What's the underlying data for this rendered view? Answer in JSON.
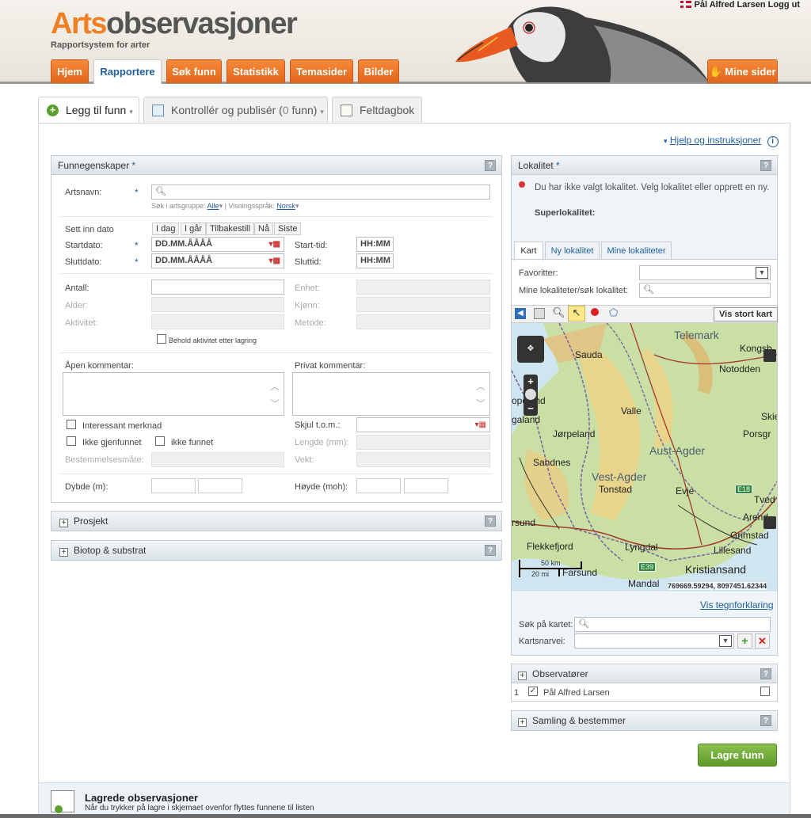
{
  "header": {
    "logo_prefix": "Arts",
    "logo_suffix": "observasjoner",
    "tagline": "Rapportsystem for arter",
    "user_name": "Pål Alfred Larsen",
    "logout": "Logg ut"
  },
  "nav": {
    "home": "Hjem",
    "report": "Rapportere",
    "search": "Søk funn",
    "stats": "Statistikk",
    "themes": "Temasider",
    "images": "Bilder",
    "my_pages": "Mine sider"
  },
  "page_tabs": {
    "add": "Legg til funn",
    "control_prefix": "Kontrollér og publisér (",
    "control_count": "0",
    "control_suffix": " funn)",
    "diary": "Feltdagbok"
  },
  "help_link": "Hjelp og instruksjoner",
  "findings": {
    "title": "Funnegenskaper",
    "species_label": "Artsnavn:",
    "search_group_label": "Søk i artsgruppe:",
    "search_group_value": "Alle",
    "display_lang_label": "Visningsspråk:",
    "display_lang_value": "Norsk",
    "insert_date_label": "Sett inn dato",
    "date_buttons": [
      "I dag",
      "I går",
      "Tilbakestill",
      "Nå",
      "Siste"
    ],
    "start_date_label": "Startdato:",
    "end_date_label": "Sluttdato:",
    "date_placeholder": "DD.MM.ÅÅÅÅ",
    "start_time_label": "Start-tid:",
    "end_time_label": "Sluttid:",
    "time_placeholder": "HH:MM",
    "count_label": "Antall:",
    "unit_label": "Enhet:",
    "age_label": "Alder:",
    "sex_label": "Kjønn:",
    "activity_label": "Aktivitet:",
    "method_label": "Metode:",
    "keep_activity": "Behold aktivitet etter lagring",
    "public_comment": "Åpen kommentar:",
    "private_comment": "Privat kommentar:",
    "interesting_note": "Interessant merknad",
    "not_refound": "Ikke gjenfunnet",
    "not_found": "ikke funnet",
    "determination_label": "Bestemmelsesmåte:",
    "hide_until_label": "Skjul t.o.m.:",
    "length_label": "Lengde (mm):",
    "weight_label": "Vekt:",
    "depth_label": "Dybde (m):",
    "height_label": "Høyde (moh):"
  },
  "project_panel": "Prosjekt",
  "biotope_panel": "Biotop & substrat",
  "locality": {
    "title": "Lokalitet",
    "notice": "Du har ikke valgt lokalitet. Velg lokalitet eller opprett en ny.",
    "super_label": "Superlokalitet:",
    "tabs": [
      "Kart",
      "Ny lokalitet",
      "Mine lokaliteter"
    ],
    "favorites_label": "Favoritter:",
    "my_search_label": "Mine lokaliteter/søk lokalitet:",
    "big_map_button": "Vis stort kart",
    "map_places": [
      "Telemark",
      "Kongsb",
      "Sauda",
      "Notodden",
      "opeland",
      "Skie",
      "Valle",
      "galand",
      "Jørpeland",
      "Porsgr",
      "Sandnes",
      "Aust-Agder",
      "Vest-Agder",
      "Tonstad",
      "Evje",
      "Tved",
      "Arend",
      "rsund",
      "Grimstad",
      "Flekkefjord",
      "Lyngdal",
      "Lillesand",
      "Farsund",
      "Kristiansand",
      "Mandal"
    ],
    "road_labels": [
      "E18",
      "E39"
    ],
    "scale_km": "50 km",
    "scale_mi": "20 mi",
    "coordinates": "769669.59294, 8097451.62344",
    "legend_link": "Vis tegnforklaring",
    "map_search_label": "Søk på kartet:",
    "map_shortcut_label": "Kartsnarvei:"
  },
  "observers": {
    "title": "Observatører",
    "rows": [
      {
        "index": "1",
        "name": "Pål Alfred Larsen"
      }
    ]
  },
  "collection_panel": "Samling & bestemmer",
  "save_button": "Lagre funn",
  "saved": {
    "title": "Lagrede observasjoner",
    "desc": "Når du trykker på lagre i skjemaet ovenfor flyttes funnene til listen"
  },
  "colors": {
    "brand_orange": "#f07f25",
    "save_green": "#6aa52f",
    "link_blue": "#1f5fa0"
  }
}
